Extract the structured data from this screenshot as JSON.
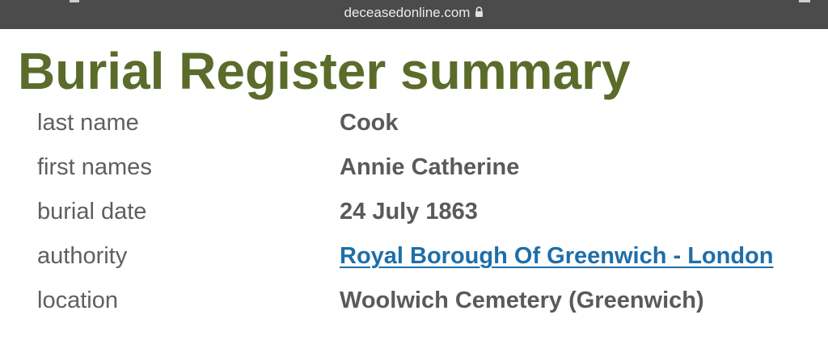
{
  "browser": {
    "url": "deceasedonline.com"
  },
  "page": {
    "title": "Burial Register summary"
  },
  "record": {
    "rows": [
      {
        "label": "last name",
        "value": "Cook"
      },
      {
        "label": "first names",
        "value": "Annie Catherine"
      },
      {
        "label": "burial date",
        "value": "24 July 1863"
      },
      {
        "label": "authority",
        "value": "Royal Borough Of Greenwich - London"
      },
      {
        "label": "location",
        "value": "Woolwich Cemetery (Greenwich)"
      }
    ]
  },
  "colors": {
    "title": "#5b6b2a",
    "label": "#5f5f5f",
    "value": "#5a5a5a",
    "link": "#1f6ea8",
    "browser_bar": "#4b4b4b"
  },
  "icons": {
    "secure": "lock-icon"
  }
}
